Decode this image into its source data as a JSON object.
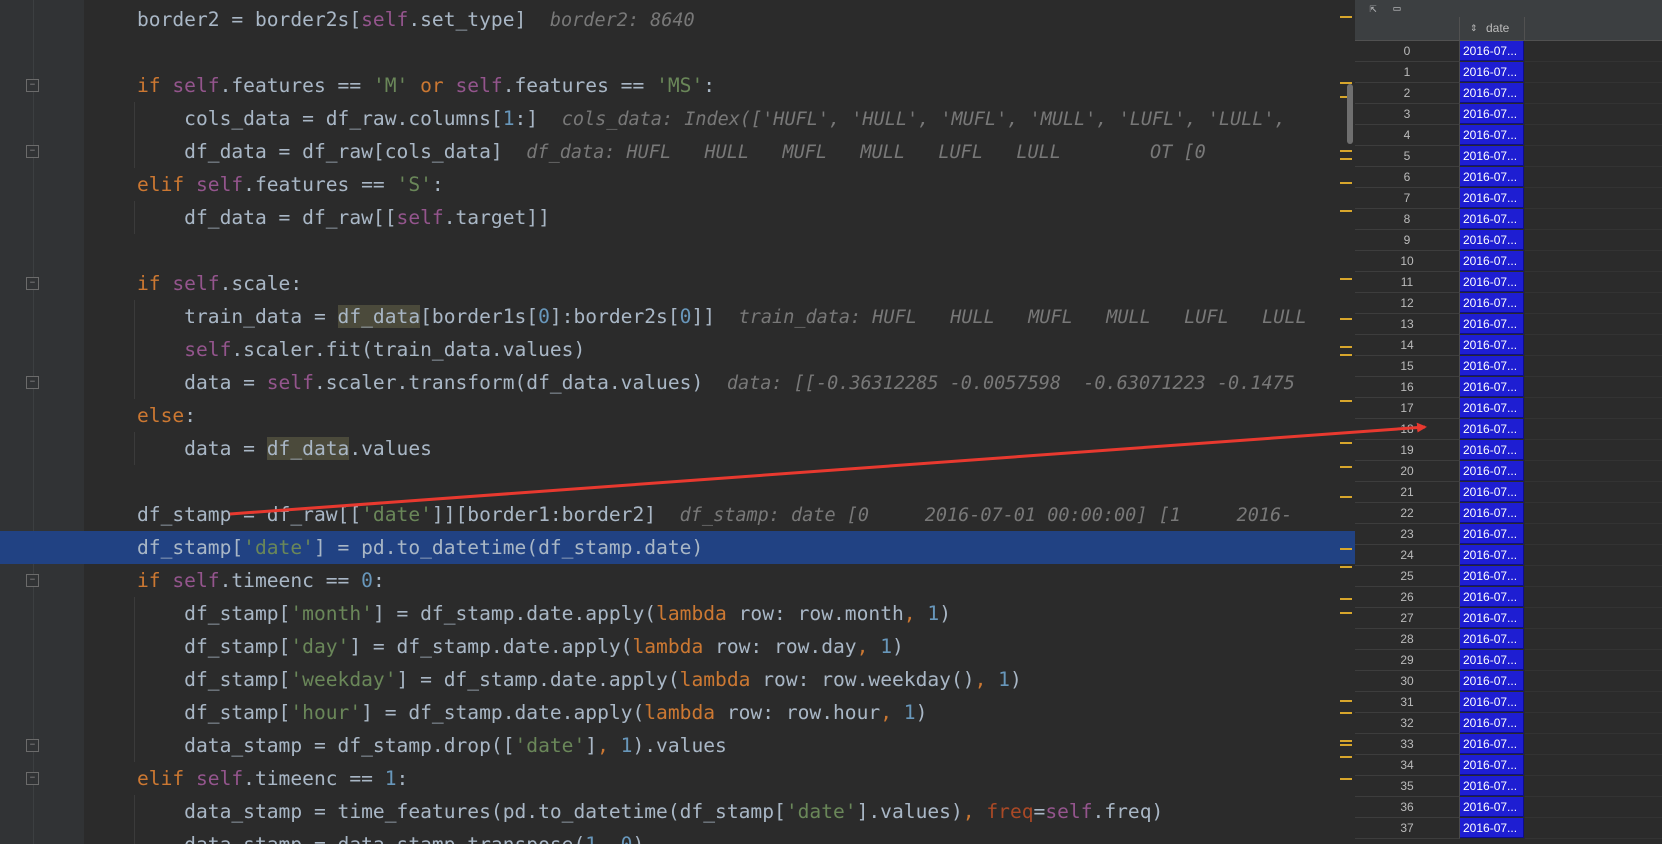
{
  "editor": {
    "lines": [
      {
        "tokens": [
          {
            "t": "border2 = border2s["
          },
          {
            "t": "self",
            "c": "self"
          },
          {
            "t": ".set_type]  "
          },
          {
            "t": "border2: 8640",
            "c": "hint"
          }
        ]
      },
      {
        "tokens": []
      },
      {
        "tokens": [
          {
            "t": "if ",
            "c": "kw"
          },
          {
            "t": "self",
            "c": "self"
          },
          {
            "t": ".features == "
          },
          {
            "t": "'M' ",
            "c": "str"
          },
          {
            "t": "or ",
            "c": "kw"
          },
          {
            "t": "self",
            "c": "self"
          },
          {
            "t": ".features == "
          },
          {
            "t": "'MS'",
            "c": "str"
          },
          {
            "t": ":"
          }
        ]
      },
      {
        "tokens": [
          {
            "t": "    cols_data = df_raw.columns["
          },
          {
            "t": "1",
            "c": "num"
          },
          {
            "t": ":]  "
          },
          {
            "t": "cols_data: Index(['HUFL', 'HULL', 'MUFL', 'MULL', 'LUFL', 'LULL',",
            "c": "hint"
          }
        ]
      },
      {
        "tokens": [
          {
            "t": "    df_data = df_raw[cols_data]  "
          },
          {
            "t": "df_data: HUFL   HULL   MUFL   MULL   LUFL   LULL        OT [0",
            "c": "hint"
          }
        ]
      },
      {
        "tokens": [
          {
            "t": "elif ",
            "c": "kw"
          },
          {
            "t": "self",
            "c": "self"
          },
          {
            "t": ".features == "
          },
          {
            "t": "'S'",
            "c": "str"
          },
          {
            "t": ":"
          }
        ]
      },
      {
        "tokens": [
          {
            "t": "    df_data = df_raw[["
          },
          {
            "t": "self",
            "c": "self"
          },
          {
            "t": ".target]]"
          }
        ]
      },
      {
        "tokens": []
      },
      {
        "tokens": [
          {
            "t": "if ",
            "c": "kw"
          },
          {
            "t": "self",
            "c": "self"
          },
          {
            "t": ".scale:"
          }
        ]
      },
      {
        "tokens": [
          {
            "t": "    train_data = "
          },
          {
            "t": "df_data",
            "c": "usage"
          },
          {
            "t": "[border1s["
          },
          {
            "t": "0",
            "c": "num"
          },
          {
            "t": "]:border2s["
          },
          {
            "t": "0",
            "c": "num"
          },
          {
            "t": "]]  "
          },
          {
            "t": "train_data: HUFL   HULL   MUFL   MULL   LUFL   LULL",
            "c": "hint"
          }
        ]
      },
      {
        "tokens": [
          {
            "t": "    "
          },
          {
            "t": "self",
            "c": "self"
          },
          {
            "t": ".scaler.fit(train_data.values)"
          }
        ]
      },
      {
        "tokens": [
          {
            "t": "    data = "
          },
          {
            "t": "self",
            "c": "self"
          },
          {
            "t": ".scaler.transform(df_data.values)  "
          },
          {
            "t": "data: [[-0.36312285 -0.0057598  -0.63071223 -0.1475",
            "c": "hint"
          }
        ]
      },
      {
        "tokens": [
          {
            "t": "else",
            "c": "kw"
          },
          {
            "t": ":"
          }
        ]
      },
      {
        "tokens": [
          {
            "t": "    data = "
          },
          {
            "t": "df_data",
            "c": "usage"
          },
          {
            "t": ".values"
          }
        ]
      },
      {
        "tokens": []
      },
      {
        "tokens": [
          {
            "t": "df_stamp = df_raw[["
          },
          {
            "t": "'date'",
            "c": "str"
          },
          {
            "t": "]][border1:border2]  "
          },
          {
            "t": "df_stamp: date [0     2016-07-01 00:00:00] [1     2016-",
            "c": "hint"
          }
        ]
      },
      {
        "tokens": [
          {
            "t": "df_stamp["
          },
          {
            "t": "'date'",
            "c": "str"
          },
          {
            "t": "] = pd.to_datetime(df_stamp.date)"
          }
        ],
        "highlight": true
      },
      {
        "tokens": [
          {
            "t": "if ",
            "c": "kw"
          },
          {
            "t": "self",
            "c": "self"
          },
          {
            "t": ".timeenc == "
          },
          {
            "t": "0",
            "c": "num"
          },
          {
            "t": ":"
          }
        ]
      },
      {
        "tokens": [
          {
            "t": "    df_stamp["
          },
          {
            "t": "'month'",
            "c": "str"
          },
          {
            "t": "] = df_stamp.date.apply("
          },
          {
            "t": "lambda ",
            "c": "kw"
          },
          {
            "t": "row: row.month"
          },
          {
            "t": ", ",
            "c": "kw"
          },
          {
            "t": "1",
            "c": "num"
          },
          {
            "t": ")"
          }
        ]
      },
      {
        "tokens": [
          {
            "t": "    df_stamp["
          },
          {
            "t": "'day'",
            "c": "str"
          },
          {
            "t": "] = df_stamp.date.apply("
          },
          {
            "t": "lambda ",
            "c": "kw"
          },
          {
            "t": "row: row.day"
          },
          {
            "t": ", ",
            "c": "kw"
          },
          {
            "t": "1",
            "c": "num"
          },
          {
            "t": ")"
          }
        ]
      },
      {
        "tokens": [
          {
            "t": "    df_stamp["
          },
          {
            "t": "'weekday'",
            "c": "str"
          },
          {
            "t": "] = df_stamp.date.apply("
          },
          {
            "t": "lambda ",
            "c": "kw"
          },
          {
            "t": "row: row.weekday()"
          },
          {
            "t": ", ",
            "c": "kw"
          },
          {
            "t": "1",
            "c": "num"
          },
          {
            "t": ")"
          }
        ]
      },
      {
        "tokens": [
          {
            "t": "    df_stamp["
          },
          {
            "t": "'hour'",
            "c": "str"
          },
          {
            "t": "] = df_stamp.date.apply("
          },
          {
            "t": "lambda ",
            "c": "kw"
          },
          {
            "t": "row: row.hour"
          },
          {
            "t": ", ",
            "c": "kw"
          },
          {
            "t": "1",
            "c": "num"
          },
          {
            "t": ")"
          }
        ]
      },
      {
        "tokens": [
          {
            "t": "    data_stamp = df_stamp.drop(["
          },
          {
            "t": "'date'",
            "c": "str"
          },
          {
            "t": "]"
          },
          {
            "t": ", ",
            "c": "kw"
          },
          {
            "t": "1",
            "c": "num"
          },
          {
            "t": ").values"
          }
        ]
      },
      {
        "tokens": [
          {
            "t": "elif ",
            "c": "kw"
          },
          {
            "t": "self",
            "c": "self"
          },
          {
            "t": ".timeenc == "
          },
          {
            "t": "1",
            "c": "num"
          },
          {
            "t": ":"
          }
        ]
      },
      {
        "tokens": [
          {
            "t": "    data_stamp = time_features(pd.to_datetime(df_stamp["
          },
          {
            "t": "'date'",
            "c": "str"
          },
          {
            "t": "].values)"
          },
          {
            "t": ", ",
            "c": "kw"
          },
          {
            "t": "freq",
            "c": "param"
          },
          {
            "t": "="
          },
          {
            "t": "self",
            "c": "self"
          },
          {
            "t": ".freq)"
          }
        ]
      },
      {
        "tokens": [
          {
            "t": "    data_stamp = data_stamp.transpose("
          },
          {
            "t": "1",
            "c": "num"
          },
          {
            "t": ", "
          },
          {
            "t": "0",
            "c": "num"
          },
          {
            "t": ")"
          }
        ]
      }
    ]
  },
  "dataview": {
    "column_header": "date",
    "cell_value": "2016-07...",
    "rows": [
      "0",
      "1",
      "2",
      "3",
      "4",
      "5",
      "6",
      "7",
      "8",
      "9",
      "10",
      "11",
      "12",
      "13",
      "14",
      "15",
      "16",
      "17",
      "18",
      "19",
      "20",
      "21",
      "22",
      "23",
      "24",
      "25",
      "26",
      "27",
      "28",
      "29",
      "30",
      "31",
      "32",
      "33",
      "34",
      "35",
      "36",
      "37"
    ]
  }
}
